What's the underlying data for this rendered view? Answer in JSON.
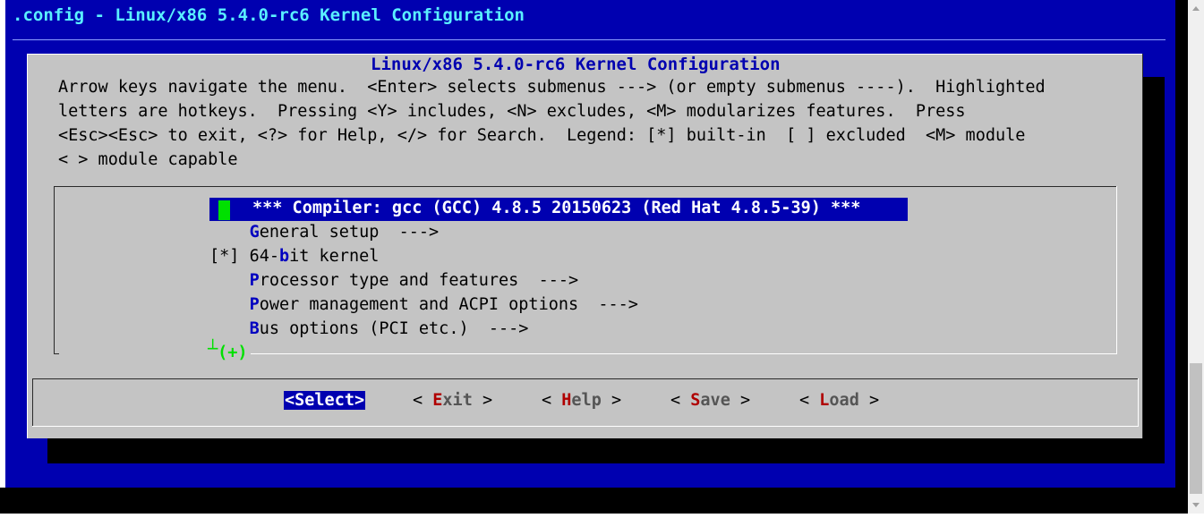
{
  "window": {
    "title": ".config - Linux/x86 5.4.0-rc6 Kernel Configuration"
  },
  "dialog": {
    "title": "Linux/x86 5.4.0-rc6 Kernel Configuration",
    "help": [
      "Arrow keys navigate the menu.  <Enter> selects submenus ---> (or empty submenus ----).  Highlighted",
      "letters are hotkeys.  Pressing <Y> includes, <N> excludes, <M> modularizes features.  Press",
      "<Esc><Esc> to exit, <?> for Help, </> for Search.  Legend: [*] built-in  [ ] excluded  <M> module",
      "< > module capable"
    ]
  },
  "menu": {
    "selected": "*** Compiler: gcc (GCC) 4.8.5 20150623 (Red Hat 4.8.5-39) ***",
    "items": [
      {
        "prefix": "    ",
        "hotkey": "G",
        "rest": "eneral setup  --->"
      },
      {
        "prefix": "[*] ",
        "pre_hot": "64-",
        "hotkey": "b",
        "rest": "it kernel"
      },
      {
        "prefix": "    ",
        "hotkey": "P",
        "rest": "rocessor type and features  --->"
      },
      {
        "prefix": "    ",
        "hotkey": "P",
        "rest": "ower management and ACPI options  --->"
      },
      {
        "prefix": "    ",
        "hotkey": "B",
        "rest": "us options (PCI etc.)  --->"
      }
    ],
    "more_indicator": "(+)",
    "more_glyph": "┴"
  },
  "buttons": {
    "select": "<Select>",
    "exit": {
      "open": "< ",
      "hotkey": "E",
      "rest": "xit",
      "close": " >"
    },
    "help": {
      "open": "< ",
      "hotkey": "H",
      "rest": "elp",
      "close": " >"
    },
    "save": {
      "open": "< ",
      "hotkey": "S",
      "rest": "ave",
      "close": " >"
    },
    "load": {
      "open": "< ",
      "hotkey": "L",
      "rest": "oad",
      "close": " >"
    }
  },
  "colors": {
    "screen_bg": "#0000b0",
    "dialog_bg": "#c4c4c4",
    "title_fg": "#5af0ff",
    "cursor": "#00e000",
    "hotkey_menu": "#0000c0",
    "hotkey_button": "#b00000"
  }
}
